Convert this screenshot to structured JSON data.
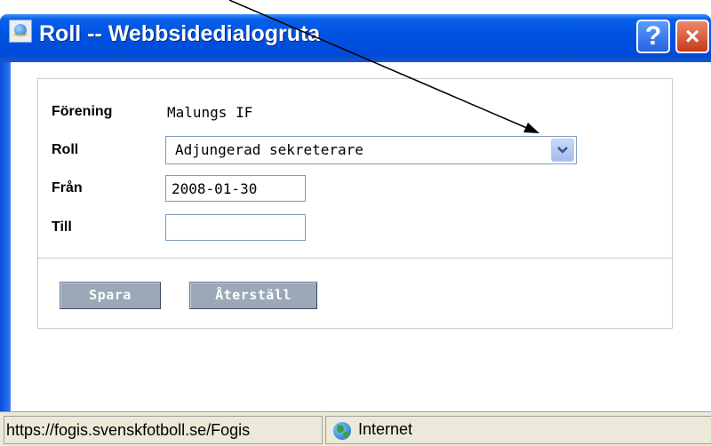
{
  "window": {
    "title": "Roll -- Webbsidedialogruta",
    "help_label": "?",
    "close_label": "×"
  },
  "form": {
    "forening": {
      "label": "Förening",
      "value": "Malungs IF"
    },
    "roll": {
      "label": "Roll",
      "selected": "Adjungerad sekreterare"
    },
    "fran": {
      "label": "Från",
      "value": "2008-01-30"
    },
    "till": {
      "label": "Till",
      "value": ""
    }
  },
  "buttons": {
    "save_label": "Spara",
    "reset_label": "Återställ"
  },
  "statusbar": {
    "url": "https://fogis.svenskfotboll.se/Fogis",
    "zone_icon": "globe-icon",
    "zone_label": "Internet"
  },
  "colors": {
    "titlebar": "#0054E3",
    "button_face": "#9AA8B8",
    "window_bg": "#ECE9D8"
  }
}
